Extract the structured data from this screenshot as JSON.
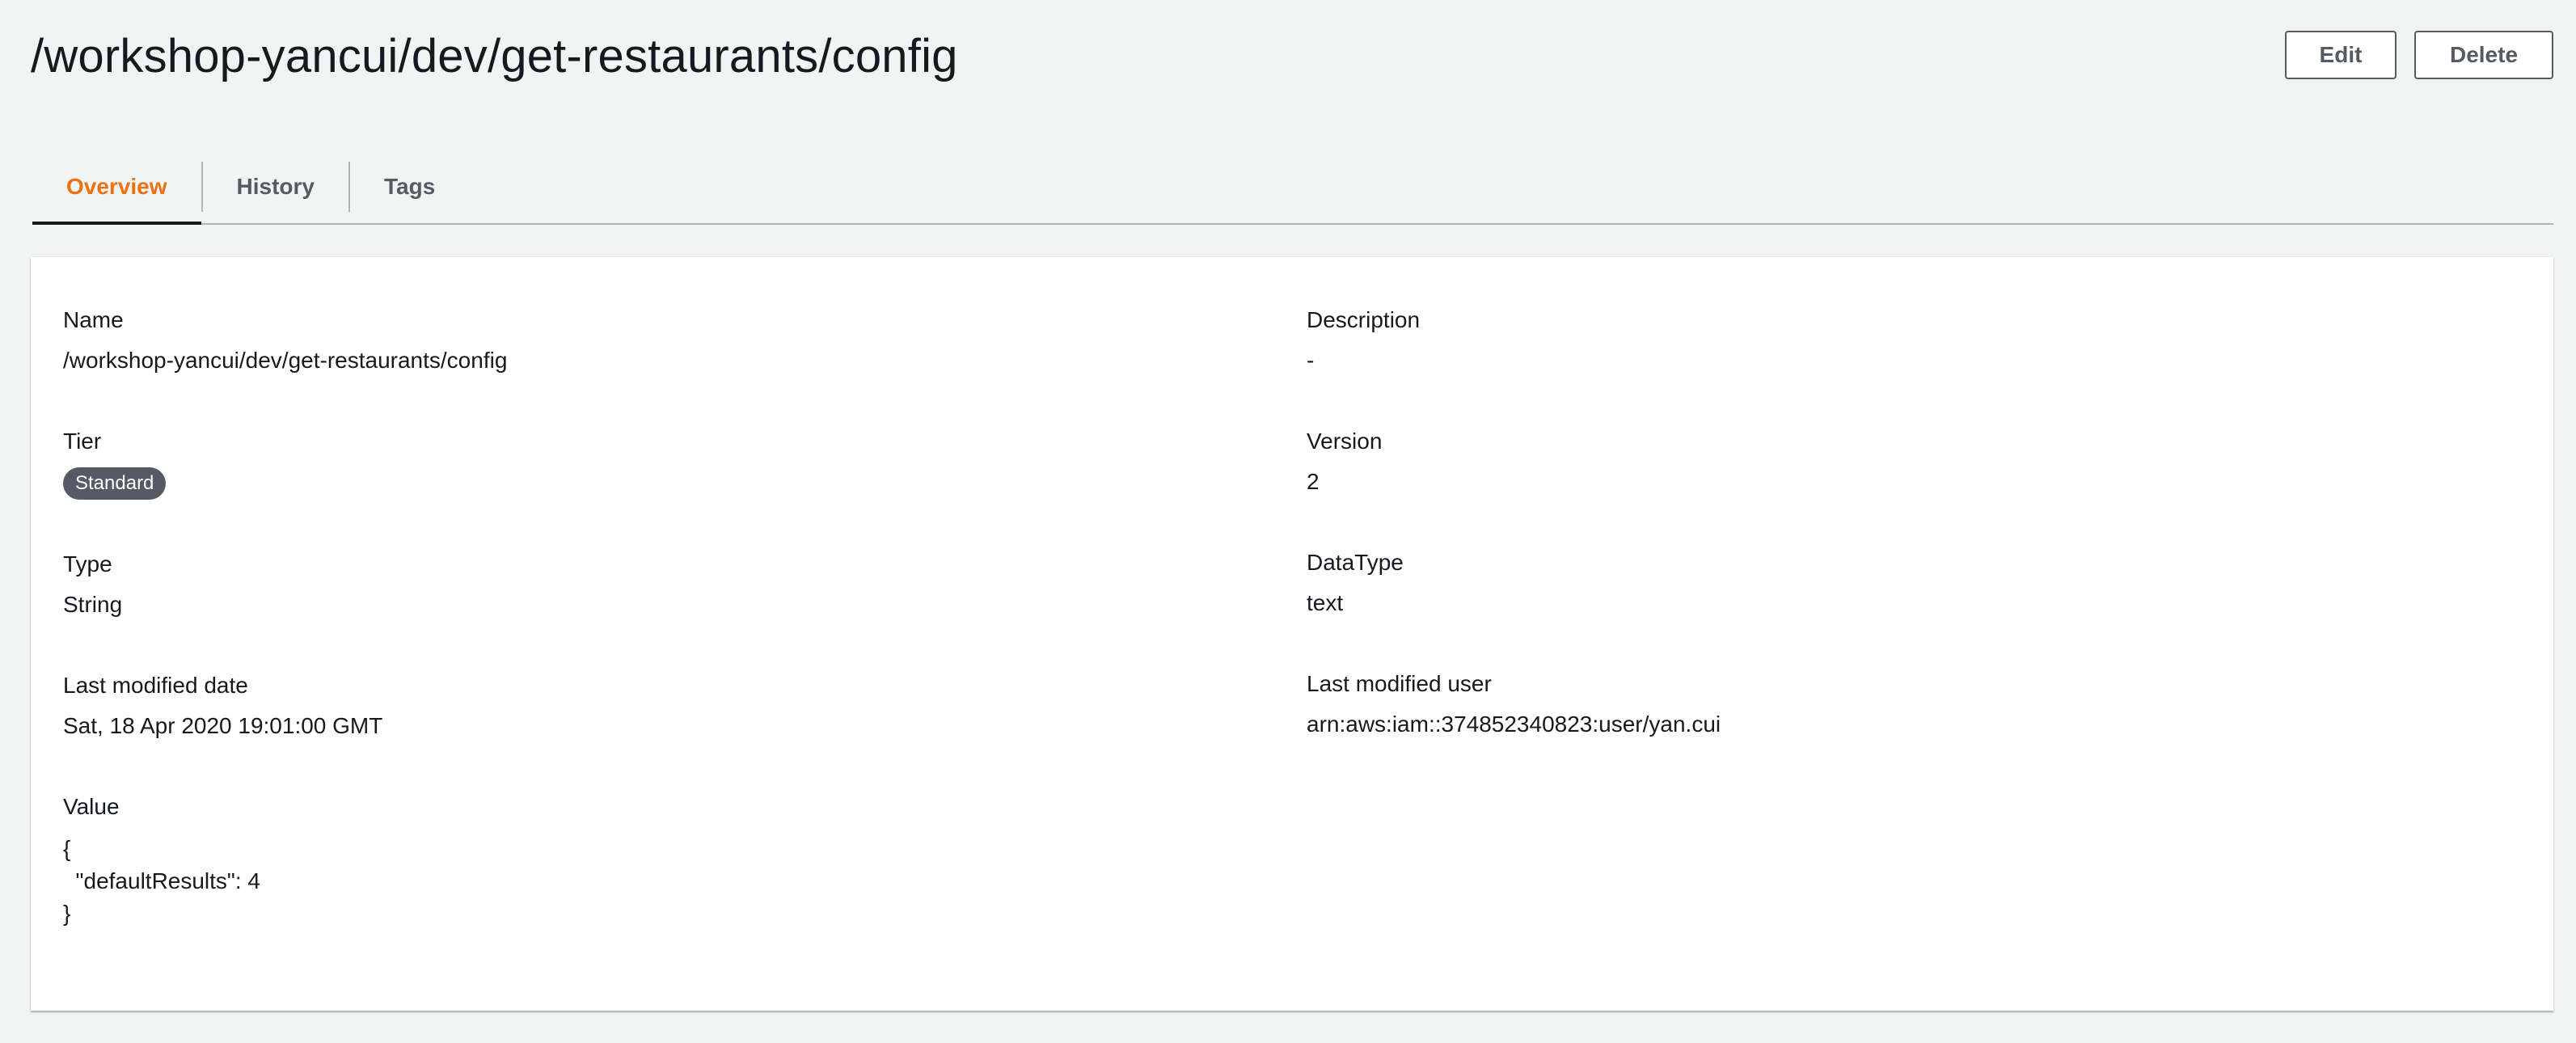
{
  "header": {
    "title": "/workshop-yancui/dev/get-restaurants/config",
    "edit_label": "Edit",
    "delete_label": "Delete"
  },
  "tabs": [
    {
      "label": "Overview",
      "active": true
    },
    {
      "label": "History",
      "active": false
    },
    {
      "label": "Tags",
      "active": false
    }
  ],
  "details": {
    "name": {
      "label": "Name",
      "value": "/workshop-yancui/dev/get-restaurants/config"
    },
    "description": {
      "label": "Description",
      "value": "-"
    },
    "tier": {
      "label": "Tier",
      "value": "Standard"
    },
    "version": {
      "label": "Version",
      "value": "2"
    },
    "type": {
      "label": "Type",
      "value": "String"
    },
    "datatype": {
      "label": "DataType",
      "value": "text"
    },
    "last_modified_date": {
      "label": "Last modified date",
      "value": "Sat, 18 Apr 2020 19:01:00 GMT"
    },
    "last_modified_user": {
      "label": "Last modified user",
      "value": "arn:aws:iam::374852340823:user/yan.cui"
    },
    "value": {
      "label": "Value",
      "value": "{\n  \"defaultResults\": 4\n}"
    }
  },
  "colors": {
    "accent": "#ec7211",
    "background": "#f2f3f3",
    "badge": "#545b64"
  }
}
